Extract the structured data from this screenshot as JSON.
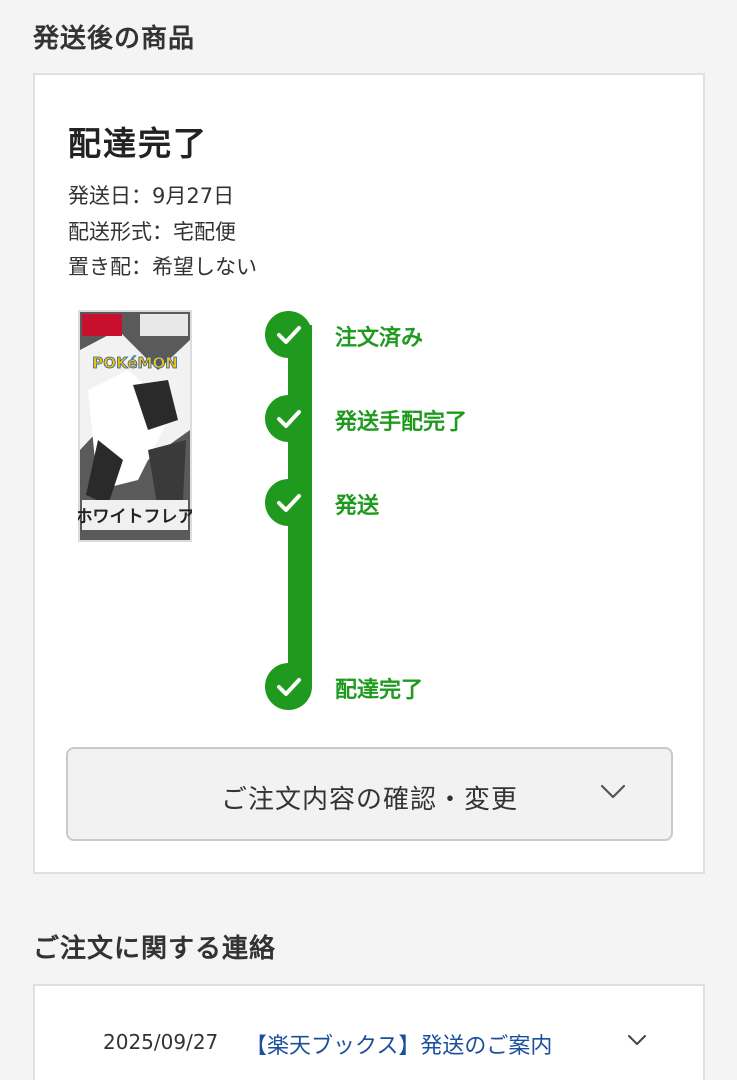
{
  "shipped_section": {
    "title": "発送後の商品",
    "status_title": "配達完了",
    "info": {
      "ship_date": "発送日：9月27日",
      "delivery_method": "配送形式：宅配便",
      "drop_off": "置き配：希望しない"
    },
    "product_image": {
      "logo_text": "POKéMON",
      "title_text": "ホワイトフレア"
    },
    "timeline": [
      {
        "label": "注文済み",
        "icon": "check-icon",
        "done": true
      },
      {
        "label": "発送手配完了",
        "icon": "check-icon",
        "done": true
      },
      {
        "label": "発送",
        "icon": "check-icon",
        "done": true
      },
      {
        "label": "配達完了",
        "icon": "check-icon",
        "done": true
      }
    ],
    "confirm_button_label": "ご注文内容の確認・変更"
  },
  "contact_section": {
    "title": "ご注文に関する連絡",
    "messages": [
      {
        "date": "2025/09/27",
        "subject": "【楽天ブックス】発送のご案内"
      }
    ]
  },
  "colors": {
    "accent_green": "#1f9a1f",
    "link_blue": "#1b4f9c",
    "background": "#f4f4f4"
  }
}
